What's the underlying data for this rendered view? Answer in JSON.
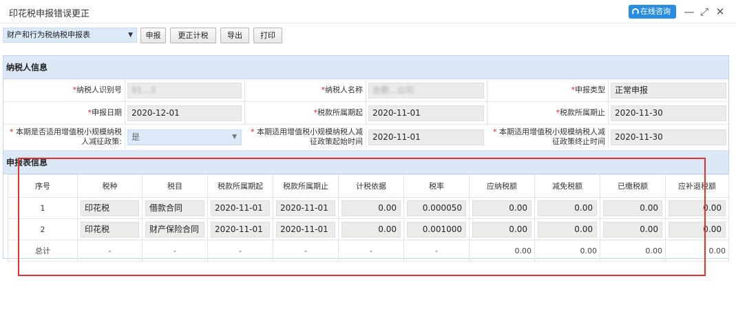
{
  "window": {
    "title": "印花税申报错误更正",
    "consult_label": "在线咨询",
    "controls": [
      "—",
      "⤢",
      "✕"
    ]
  },
  "toolbar": {
    "form_select": "财产和行为税纳税申报表",
    "buttons": [
      "申报",
      "更正计税",
      "导出",
      "打印"
    ]
  },
  "taxpayer": {
    "section_title": "纳税人信息",
    "fields": [
      {
        "label": "纳税人识别号",
        "value": "91…3",
        "obscured": true
      },
      {
        "label": "纳税人名称",
        "value": "合肥…公司",
        "obscured": true
      },
      {
        "label": "申报类型",
        "value": "正常申报"
      },
      {
        "label": "申报日期",
        "value": "2020-12-01"
      },
      {
        "label": "税款所属期起",
        "value": "2020-11-01"
      },
      {
        "label": "税款所属期止",
        "value": "2020-11-30"
      },
      {
        "label": "本期是否适用增值税小规模纳税人减征政策:",
        "value": "是"
      },
      {
        "label": "本期适用增值税小规模纳税人减征政策起始时间",
        "value": "2020-11-01"
      },
      {
        "label": "本期适用增值税小规模纳税人减征政策终止时间",
        "value": "2020-11-30"
      }
    ]
  },
  "declaration": {
    "section_title": "申报表信息",
    "columns": [
      "序号",
      "税种",
      "税目",
      "税款所属期起",
      "税款所属期止",
      "计税依据",
      "税率",
      "应纳税额",
      "减免税额",
      "已缴税额",
      "应补退税额"
    ],
    "rows": [
      [
        "1",
        "印花税",
        "借款合同",
        "2020-11-01",
        "2020-11-01",
        "0.00",
        "0.000050",
        "0.00",
        "0.00",
        "0.00",
        "0.00"
      ],
      [
        "2",
        "印花税",
        "财产保险合同",
        "2020-11-01",
        "2020-11-01",
        "0.00",
        "0.001000",
        "0.00",
        "0.00",
        "0.00",
        "0.00"
      ]
    ],
    "total_row": [
      "总计",
      "-",
      "-",
      "-",
      "-",
      "-",
      "-",
      "0.00",
      "0.00",
      "0.00",
      "0.00"
    ]
  },
  "colors": {
    "accent": "#2a8de0",
    "section_header": "#dce8f6",
    "highlight_box": "#e03030"
  }
}
